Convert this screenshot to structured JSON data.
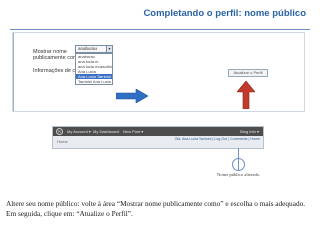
{
  "slide": {
    "title": "Completando o perfil: nome público",
    "instruction": "Altere seu nome público: volte à área “Mostrar nome publicamente como” e escolha o mais adequado. Em seguida, clique em: “Atualize o Perfil”."
  },
  "form": {
    "label_line1": "Mostrar nome",
    "label_line2": "publicamente como",
    "label_info": "Informações de cont",
    "select_value": "anaburau",
    "options": [
      "anaburau",
      "ana.lucia.m",
      "ana lucia mussolini",
      "Ana Lucia",
      "Ana Lucia Tarrinini",
      "Tarrinini Ana Lucia"
    ],
    "selected_index": 4,
    "profile_button": "Atualizar o Perfil"
  },
  "admin_bar": {
    "logo": "W",
    "links": [
      "My Account ▾",
      "My Dashboard",
      "New Post ▾"
    ],
    "blog_info": "Blog Info ▾",
    "sub_left": "Home",
    "sub_right": "Olá, Ana Lucia Tarrinini | Log Out | Comments | Home"
  },
  "caption": "Nome público alterado.",
  "colors": {
    "title": "#2a63a4",
    "arrow_fill": "#2f6fc4",
    "arrow_up_fill": "#c23a2c",
    "admin_bar": "#4d4d4d"
  },
  "icons": {
    "arrow_right": "arrow-right-icon",
    "arrow_up": "arrow-up-icon",
    "wordpress_logo": "wordpress-logo-icon"
  }
}
